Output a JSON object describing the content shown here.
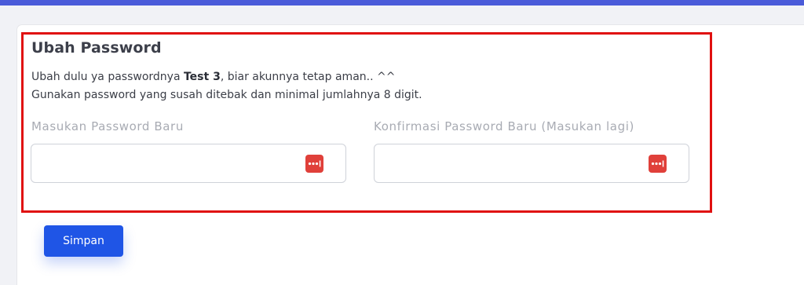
{
  "colors": {
    "top_bar": "#4a5bd9",
    "highlight_border": "#e01010",
    "primary_button": "#1f55e6",
    "password_icon": "#e0403a"
  },
  "form": {
    "title": "Ubah Password",
    "desc_line1_prefix": "Ubah dulu ya passwordnya ",
    "username": "Test 3",
    "desc_line1_suffix": ", biar akunnya tetap aman.. ^^",
    "desc_line2": "Gunakan password yang susah ditebak dan minimal jumlahnya 8 digit.",
    "new_password": {
      "label": "Masukan Password Baru",
      "value": "",
      "icon": "password-manager-icon"
    },
    "confirm_password": {
      "label": "Konfirmasi Password Baru (Masukan lagi)",
      "value": "",
      "icon": "password-manager-icon"
    },
    "save_label": "Simpan"
  }
}
